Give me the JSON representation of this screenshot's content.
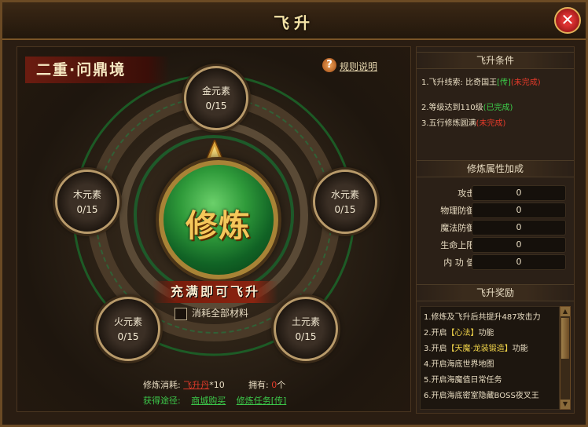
{
  "window": {
    "title": "飞升",
    "close_label": "✕"
  },
  "stage": {
    "name": "二重·问鼎境"
  },
  "help": {
    "icon": "?",
    "link_label": "规则说明"
  },
  "elements": [
    {
      "name": "金元素",
      "count": "0/15"
    },
    {
      "name": "木元素",
      "count": "0/15"
    },
    {
      "name": "水元素",
      "count": "0/15"
    },
    {
      "name": "火元素",
      "count": "0/15"
    },
    {
      "name": "土元素",
      "count": "0/15"
    }
  ],
  "orb": {
    "label": "修炼"
  },
  "ascend_banner": "充满即可飞升",
  "consume_all_label": "消耗全部材料",
  "cost": {
    "label": "修炼消耗:",
    "item": "飞升丹",
    "qty": "*10",
    "own_label": "拥有:",
    "own_value": "0",
    "own_unit": "个"
  },
  "acquire": {
    "label": "获得途径:",
    "links": [
      "商城购买",
      "修炼任务[传]"
    ]
  },
  "conditions": {
    "title": "飞升条件",
    "items": [
      {
        "text": "1.飞升线索: 比奇国王",
        "tag": "[传]",
        "status": "(未完成)"
      },
      {
        "text": "2.等级达到110级",
        "status": "(已完成)"
      },
      {
        "text": "3.五行修炼圆满",
        "status": "(未完成)"
      }
    ]
  },
  "attributes": {
    "title": "修炼属性加成",
    "rows": [
      {
        "label": "攻击:",
        "value": "0"
      },
      {
        "label": "物理防御:",
        "value": "0"
      },
      {
        "label": "魔法防御:",
        "value": "0"
      },
      {
        "label": "生命上限:",
        "value": "0"
      },
      {
        "label": "内 功 值:",
        "value": "0"
      }
    ]
  },
  "rewards": {
    "title": "飞升奖励",
    "items": [
      {
        "pre": "1.修炼及飞升后共提升487攻击力",
        "hl": "",
        "post": ""
      },
      {
        "pre": "2.开启",
        "hl": "【心法】",
        "post": "功能"
      },
      {
        "pre": "3.开启",
        "hl": "【天魔·龙装锻造】",
        "post": "功能"
      },
      {
        "pre": "4.开启海底世界地图",
        "hl": "",
        "post": ""
      },
      {
        "pre": "5.开启海魔值日常任务",
        "hl": "",
        "post": ""
      },
      {
        "pre": "6.开启海底密室隐藏BOSS夜叉王",
        "hl": "",
        "post": ""
      }
    ]
  },
  "colors": {
    "accent_gold": "#f4c75a",
    "complete_green": "#3cd04a",
    "incomplete_red": "#e63a2a",
    "orb_green": "#2f9a3a"
  }
}
